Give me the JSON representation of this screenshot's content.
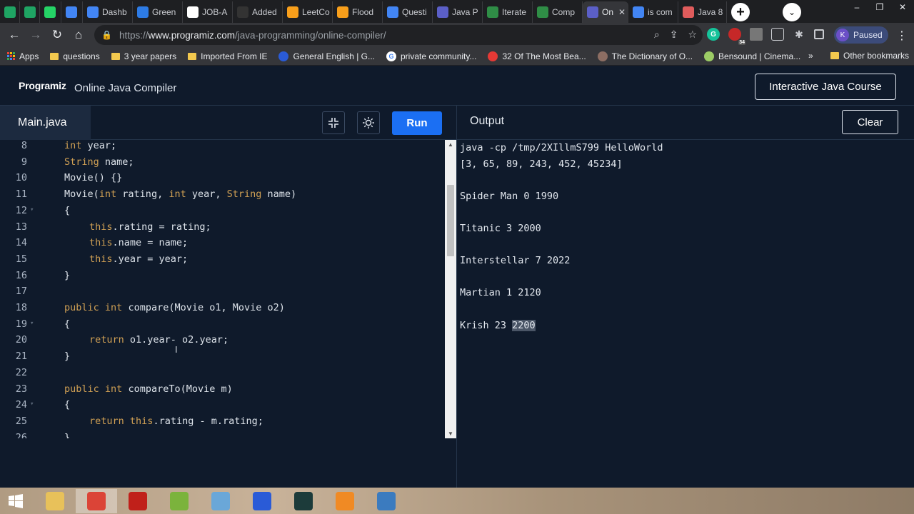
{
  "browser": {
    "tabs": [
      {
        "label": "",
        "icon": "sheets-icon",
        "color": "#1fa463"
      },
      {
        "label": "",
        "icon": "sheets-icon",
        "color": "#1fa463"
      },
      {
        "label": "",
        "icon": "whatsapp-icon",
        "color": "#25d366"
      },
      {
        "label": "",
        "icon": "google-icon",
        "color": "#4285f4"
      },
      {
        "label": "Dashb",
        "icon": "google-icon",
        "color": "#4285f4"
      },
      {
        "label": "Green",
        "icon": "k-icon",
        "color": "#2d7be5"
      },
      {
        "label": "JOB-A",
        "icon": "doc-icon",
        "color": "#ffffff"
      },
      {
        "label": "Added",
        "icon": "github-icon",
        "color": "#333333"
      },
      {
        "label": "LeetCo",
        "icon": "leetcode-icon",
        "color": "#f89f1b"
      },
      {
        "label": "Flood",
        "icon": "leetcode-icon",
        "color": "#f89f1b"
      },
      {
        "label": "Questi",
        "icon": "docs-icon",
        "color": "#4285f4"
      },
      {
        "label": "Java P",
        "icon": "programiz-icon",
        "color": "#5b5fc7"
      },
      {
        "label": "Iterate",
        "icon": "gfg-icon",
        "color": "#2f8d46"
      },
      {
        "label": "Comp",
        "icon": "gfg-icon",
        "color": "#2f8d46"
      },
      {
        "label": "On",
        "icon": "programiz-icon",
        "color": "#5b5fc7",
        "active": true
      },
      {
        "label": "is com",
        "icon": "google-icon",
        "color": "#4285f4"
      },
      {
        "label": "Java 8",
        "icon": "infinity-icon",
        "color": "#e05c5c"
      }
    ],
    "address": {
      "scheme": "https://",
      "host": "www.programiz.com",
      "path": "/java-programming/online-compiler/"
    },
    "profile": {
      "initial": "K",
      "status": "Paused"
    },
    "extension_badge": "34",
    "bookmarks": [
      {
        "label": "Apps",
        "icon": "apps-icon"
      },
      {
        "label": "questions",
        "icon": "folder-icon"
      },
      {
        "label": "3 year papers",
        "icon": "folder-icon"
      },
      {
        "label": "Imported From IE",
        "icon": "folder-icon"
      },
      {
        "label": "General English | G...",
        "icon": "bookmark-favicon"
      },
      {
        "label": "private community...",
        "icon": "google-icon"
      },
      {
        "label": "32 Of The Most Bea...",
        "icon": "bookmark-favicon"
      },
      {
        "label": "The Dictionary of O...",
        "icon": "bookmark-favicon"
      },
      {
        "label": "Bensound | Cinema...",
        "icon": "bookmark-favicon"
      }
    ],
    "bookmarks_more": "»",
    "other_bookmarks": "Other bookmarks"
  },
  "page": {
    "logo": "Programiz",
    "title": "Online Java Compiler",
    "course_button": "Interactive Java Course",
    "file_tab": "Main.java",
    "run_button": "Run",
    "output_label": "Output",
    "clear_button": "Clear"
  },
  "editor": {
    "lines": [
      {
        "n": "8",
        "fold": "",
        "indent": 1,
        "tokens": [
          {
            "t": "int",
            "c": "ty"
          },
          {
            "t": " year;",
            "c": ""
          }
        ]
      },
      {
        "n": "9",
        "fold": "",
        "indent": 1,
        "tokens": [
          {
            "t": "String",
            "c": "ty"
          },
          {
            "t": " name;",
            "c": ""
          }
        ]
      },
      {
        "n": "10",
        "fold": "",
        "indent": 1,
        "tokens": [
          {
            "t": "Movie() {}",
            "c": ""
          }
        ]
      },
      {
        "n": "11",
        "fold": "",
        "indent": 1,
        "tokens": [
          {
            "t": "Movie(",
            "c": ""
          },
          {
            "t": "int",
            "c": "ty"
          },
          {
            "t": " rating, ",
            "c": ""
          },
          {
            "t": "int",
            "c": "ty"
          },
          {
            "t": " year, ",
            "c": ""
          },
          {
            "t": "String",
            "c": "ty"
          },
          {
            "t": " name)",
            "c": ""
          }
        ]
      },
      {
        "n": "12",
        "fold": "▾",
        "indent": 1,
        "tokens": [
          {
            "t": "{",
            "c": ""
          }
        ]
      },
      {
        "n": "13",
        "fold": "",
        "indent": 2,
        "tokens": [
          {
            "t": "this",
            "c": "kw"
          },
          {
            "t": ".rating = rating;",
            "c": ""
          }
        ]
      },
      {
        "n": "14",
        "fold": "",
        "indent": 2,
        "tokens": [
          {
            "t": "this",
            "c": "kw"
          },
          {
            "t": ".name = name;",
            "c": ""
          }
        ]
      },
      {
        "n": "15",
        "fold": "",
        "indent": 2,
        "tokens": [
          {
            "t": "this",
            "c": "kw"
          },
          {
            "t": ".year = year;",
            "c": ""
          }
        ]
      },
      {
        "n": "16",
        "fold": "",
        "indent": 1,
        "tokens": [
          {
            "t": "}",
            "c": ""
          }
        ]
      },
      {
        "n": "17",
        "fold": "",
        "indent": 1,
        "tokens": []
      },
      {
        "n": "18",
        "fold": "",
        "indent": 1,
        "tokens": [
          {
            "t": "public",
            "c": "kw"
          },
          {
            "t": " ",
            "c": ""
          },
          {
            "t": "int",
            "c": "ty"
          },
          {
            "t": " compare(Movie o1, Movie o2)",
            "c": ""
          }
        ]
      },
      {
        "n": "19",
        "fold": "▾",
        "indent": 1,
        "tokens": [
          {
            "t": "{",
            "c": ""
          }
        ]
      },
      {
        "n": "20",
        "fold": "",
        "indent": 2,
        "tokens": [
          {
            "t": "return",
            "c": "kw"
          },
          {
            "t": " o1.year- o2.year;",
            "c": ""
          }
        ]
      },
      {
        "n": "21",
        "fold": "",
        "indent": 1,
        "tokens": [
          {
            "t": "}",
            "c": ""
          }
        ]
      },
      {
        "n": "22",
        "fold": "",
        "indent": 1,
        "tokens": []
      },
      {
        "n": "23",
        "fold": "",
        "indent": 1,
        "tokens": [
          {
            "t": "public",
            "c": "kw"
          },
          {
            "t": " ",
            "c": ""
          },
          {
            "t": "int",
            "c": "ty"
          },
          {
            "t": " compareTo(Movie m)",
            "c": ""
          }
        ]
      },
      {
        "n": "24",
        "fold": "▾",
        "indent": 1,
        "tokens": [
          {
            "t": "{",
            "c": ""
          }
        ]
      },
      {
        "n": "25",
        "fold": "",
        "indent": 2,
        "tokens": [
          {
            "t": "return",
            "c": "kw"
          },
          {
            "t": " ",
            "c": ""
          },
          {
            "t": "this",
            "c": "kw"
          },
          {
            "t": ".rating - m.rating;",
            "c": ""
          }
        ]
      },
      {
        "n": "26",
        "fold": "",
        "indent": 1,
        "tokens": [
          {
            "t": "}",
            "c": ""
          }
        ]
      }
    ]
  },
  "output": {
    "lines": [
      {
        "text": "java -cp /tmp/2XIllmS799 HelloWorld",
        "sel": ""
      },
      {
        "text": "[3, 65, 89, 243, 452, 45234]",
        "sel": ""
      },
      {
        "text": "",
        "sel": ""
      },
      {
        "text": "Spider Man 0 1990",
        "sel": ""
      },
      {
        "text": "",
        "sel": ""
      },
      {
        "text": "Titanic 3 2000",
        "sel": ""
      },
      {
        "text": "",
        "sel": ""
      },
      {
        "text": "Interstellar 7 2022",
        "sel": ""
      },
      {
        "text": "",
        "sel": ""
      },
      {
        "text": "Martian 1 2120",
        "sel": ""
      },
      {
        "text": "",
        "sel": ""
      },
      {
        "text": "Krish 23 ",
        "sel": "2200"
      }
    ]
  },
  "taskbar": {
    "apps": [
      {
        "icon": "file-explorer-icon",
        "color": "#e8c15a"
      },
      {
        "icon": "chrome-icon",
        "color": "#db4437",
        "active": true
      },
      {
        "icon": "acrobat-icon",
        "color": "#c0201a"
      },
      {
        "icon": "notepad-icon",
        "color": "#7bb33c"
      },
      {
        "icon": "app-icon",
        "color": "#6aa7d8"
      },
      {
        "icon": "audacity-icon",
        "color": "#2a5bd7"
      },
      {
        "icon": "filmora-icon",
        "color": "#1c3b3a"
      },
      {
        "icon": "media-player-icon",
        "color": "#f08a24"
      },
      {
        "icon": "image-viewer-icon",
        "color": "#3b7bbf"
      }
    ]
  }
}
